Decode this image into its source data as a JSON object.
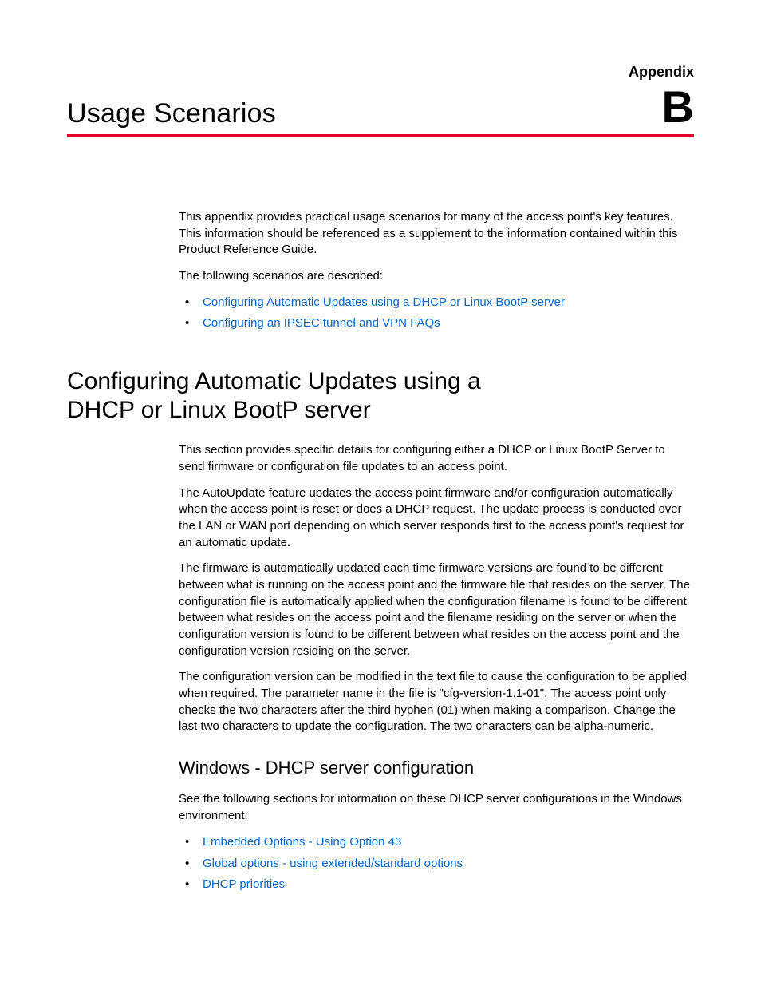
{
  "header": {
    "appendix_label": "Appendix",
    "appendix_letter": "B",
    "title": "Usage Scenarios"
  },
  "intro": {
    "p1": "This appendix provides practical usage scenarios for many of the access point's key features. This information should be referenced as a supplement to the information contained within this Product Reference Guide.",
    "p2": "The following scenarios are described:",
    "links": {
      "l1": "Configuring Automatic Updates using a DHCP or Linux BootP server",
      "l2": "Configuring an IPSEC tunnel and VPN FAQs"
    }
  },
  "section1": {
    "heading": "Configuring Automatic Updates using a DHCP or Linux BootP server",
    "p1": "This section provides specific details for configuring either a DHCP or Linux BootP Server to send firmware or configuration file updates to an access point.",
    "p2": "The AutoUpdate feature updates the access point firmware and/or configuration automatically when the access point is reset or does a DHCP request. The update process is conducted over the LAN or WAN port depending on which server responds first to the access point's request for an automatic update.",
    "p3": "The firmware is automatically updated each time firmware versions are found to be different between what is running on the access point and the firmware file that resides on the server. The configuration file is automatically applied when the configuration filename is found to be different between what resides on the access point and the filename residing on the server or when the configuration version is found to be different between what resides on the access point and the configuration version residing on the server.",
    "p4": "The configuration version can be modified in the text file to cause the configuration to be applied when required. The parameter name in the file is \"cfg-version-1.1-01\". The access point only checks the two characters after the third hyphen (01) when making a comparison. Change the last two characters to update the configuration. The two characters can be alpha-numeric."
  },
  "sub1": {
    "heading": "Windows - DHCP server configuration",
    "p1": "See the following sections for information on these DHCP server configurations in the Windows environment:",
    "links": {
      "l1": "Embedded Options - Using Option 43",
      "l2": "Global options - using extended/standard options",
      "l3": "DHCP priorities"
    }
  }
}
